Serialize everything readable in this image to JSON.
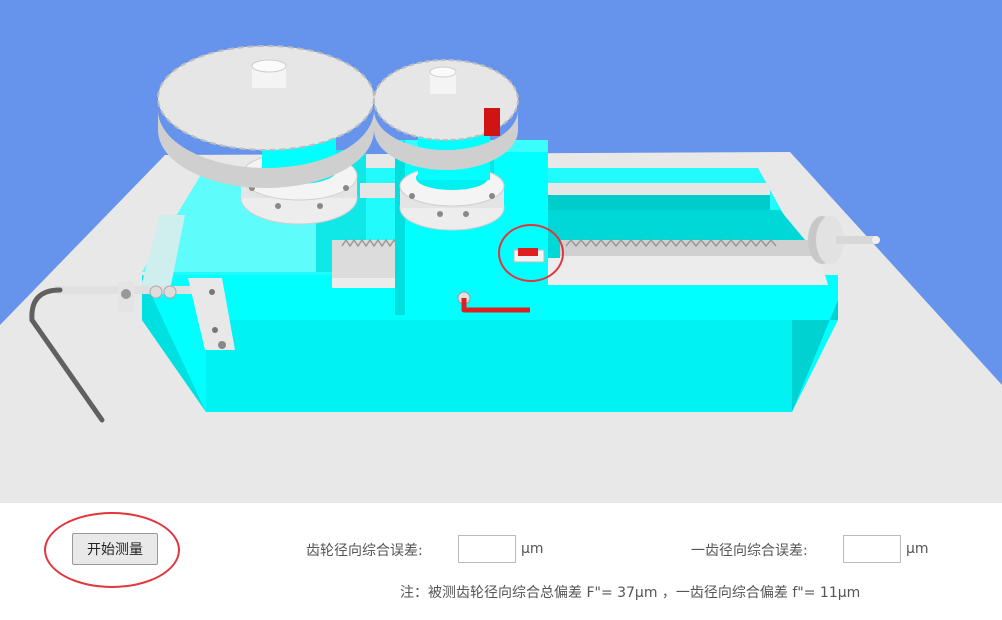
{
  "colors": {
    "sky": "#6693ec",
    "table": "#e8e8e8",
    "machine_cyan": "#00ffff",
    "machine_cyan_shade": "#00d6d6",
    "gear": "#e6e6e6",
    "marker": "#e02020",
    "annotation_circle": "#e2363d"
  },
  "icons": {
    "large_gear": "large-gear-icon",
    "small_gear": "small-gear-icon",
    "rack": "rack-icon",
    "hand_wheel": "hand-wheel-icon",
    "lever": "lever-icon",
    "indicator": "indicator-marker-icon"
  },
  "controls": {
    "start_button": "开始测量",
    "total_error_label": "齿轮径向综合误差:",
    "total_error_value": "",
    "total_error_unit": "μm",
    "tooth_error_label": "一齿径向综合误差:",
    "tooth_error_value": "",
    "tooth_error_unit": "μm",
    "note": "注：被测齿轮径向综合总偏差 F\"= 37μm ，一齿径向综合偏差 f\"= 11μm"
  }
}
